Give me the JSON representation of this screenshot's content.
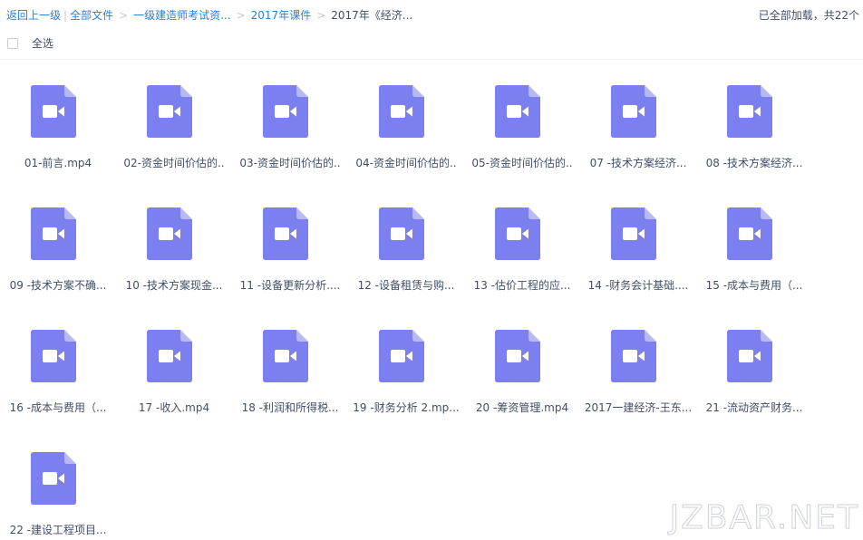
{
  "breadcrumb": {
    "back": "返回上一级",
    "items": [
      "全部文件",
      "一级建造师考试资...",
      "2017年课件"
    ],
    "current": "2017年《经济..."
  },
  "load_status": "已全部加载，共22个",
  "select_all_label": "全选",
  "icon_color": "#7b7ff0",
  "files": [
    {
      "name": "01-前言.mp4",
      "icon": "video-file-icon"
    },
    {
      "name": "02-资金时间价估的..",
      "icon": "video-file-icon"
    },
    {
      "name": "03-资金时间价估的..",
      "icon": "video-file-icon"
    },
    {
      "name": "04-资金时间价估的..",
      "icon": "video-file-icon"
    },
    {
      "name": "05-资金时间价估的..",
      "icon": "video-file-icon"
    },
    {
      "name": "07 -技术方案经济...",
      "icon": "video-file-icon"
    },
    {
      "name": "08 -技术方案经济...",
      "icon": "video-file-icon"
    },
    {
      "name": "09 -技术方案不确...",
      "icon": "video-file-icon"
    },
    {
      "name": "10 -技术方案现金...",
      "icon": "video-file-icon"
    },
    {
      "name": "11 -设备更新分析....",
      "icon": "video-file-icon"
    },
    {
      "name": "12 -设备租赁与购...",
      "icon": "video-file-icon"
    },
    {
      "name": "13 -估价工程的应...",
      "icon": "video-file-icon"
    },
    {
      "name": "14 -财务会计基础....",
      "icon": "video-file-icon"
    },
    {
      "name": "15 -成本与费用（...",
      "icon": "video-file-icon"
    },
    {
      "name": "16 -成本与费用（...",
      "icon": "video-file-icon"
    },
    {
      "name": "17 -收入.mp4",
      "icon": "video-file-icon"
    },
    {
      "name": "18 -利润和所得税...",
      "icon": "video-file-icon"
    },
    {
      "name": "19 -财务分析 2.mp...",
      "icon": "video-file-icon"
    },
    {
      "name": "20 -筹资管理.mp4",
      "icon": "video-file-icon"
    },
    {
      "name": "2017一建经济-王东...",
      "icon": "video-file-icon"
    },
    {
      "name": "21 -流动资产财务...",
      "icon": "video-file-icon"
    },
    {
      "name": "22 -建设工程项目...",
      "icon": "video-file-icon"
    }
  ],
  "watermark": "JZBAR.NET"
}
